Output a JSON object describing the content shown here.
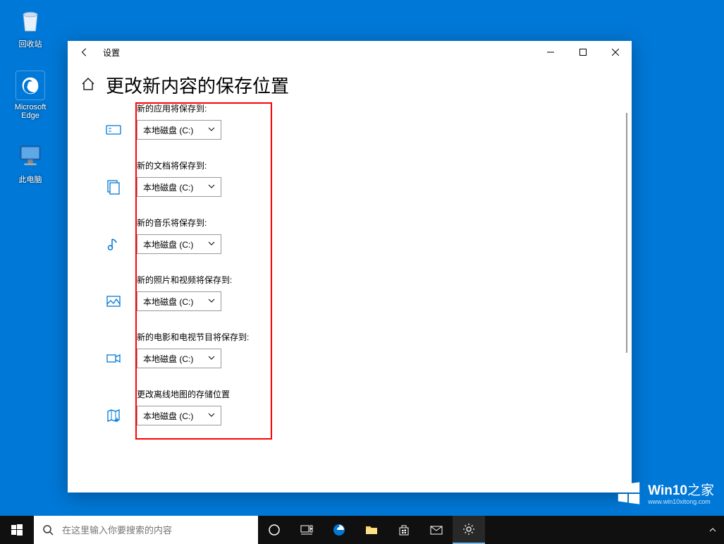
{
  "desktop": {
    "recycle_bin": "回收站",
    "edge": "Microsoft Edge",
    "this_pc": "此电脑"
  },
  "window": {
    "title": "设置",
    "page_title": "更改新内容的保存位置"
  },
  "sections": [
    {
      "label": "新的应用将保存到:",
      "value": "本地磁盘 (C:)",
      "icon": "apps"
    },
    {
      "label": "新的文档将保存到:",
      "value": "本地磁盘 (C:)",
      "icon": "documents"
    },
    {
      "label": "新的音乐将保存到:",
      "value": "本地磁盘 (C:)",
      "icon": "music"
    },
    {
      "label": "新的照片和视频将保存到:",
      "value": "本地磁盘 (C:)",
      "icon": "pictures"
    },
    {
      "label": "新的电影和电视节目将保存到:",
      "value": "本地磁盘 (C:)",
      "icon": "videos"
    },
    {
      "label": "更改离线地图的存储位置",
      "value": "本地磁盘 (C:)",
      "icon": "maps"
    }
  ],
  "taskbar": {
    "search_placeholder": "在这里输入你要搜索的内容"
  },
  "watermark": {
    "brand": "Win10",
    "suffix": "之家",
    "url": "www.win10xitong.com"
  }
}
